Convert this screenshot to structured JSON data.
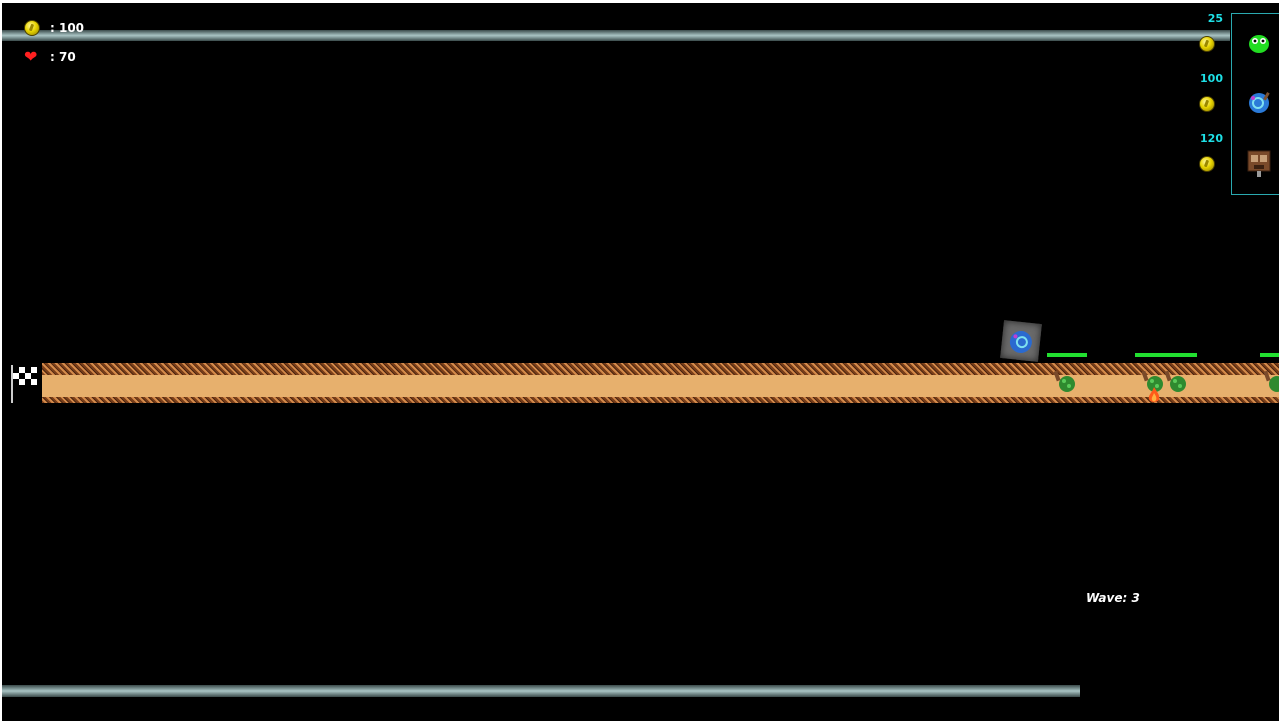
{
  "hud": {
    "coins_label": ": 100",
    "lives_label": ": 70",
    "coin_icon": "coin-icon",
    "heart_icon": "heart-icon"
  },
  "shop": {
    "items": [
      {
        "name": "green-blob-tower",
        "price": "25"
      },
      {
        "name": "blue-orb-tower",
        "price": "100"
      },
      {
        "name": "wooden-cabinet-tower",
        "price": "120"
      }
    ]
  },
  "wave": {
    "label": "Wave: 3"
  },
  "colors": {
    "accent": "#2aa9b0",
    "price_text": "#1ee0e6",
    "health_bar": "#22e030",
    "path_sand": "#e7b06d"
  }
}
